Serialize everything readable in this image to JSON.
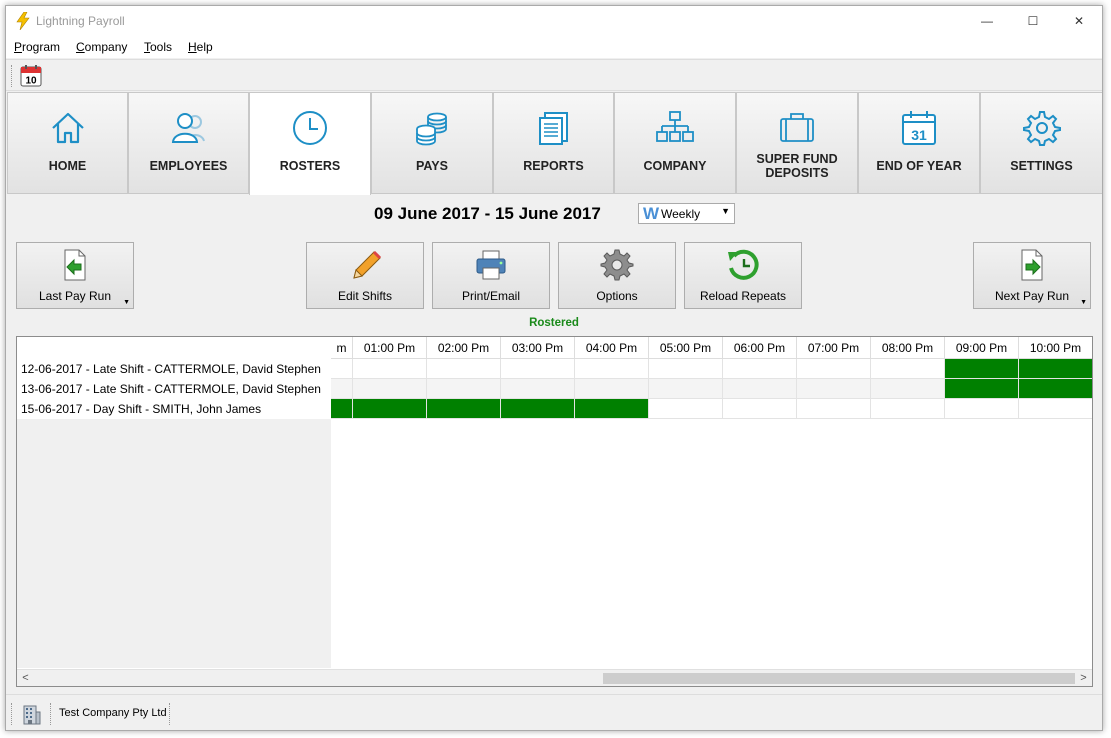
{
  "window": {
    "title": "Lightning Payroll",
    "minimize_glyph": "—",
    "maximize_glyph": "☐",
    "close_glyph": "✕"
  },
  "menu": [
    {
      "accel": "P",
      "rest": "rogram"
    },
    {
      "accel": "C",
      "rest": "ompany"
    },
    {
      "accel": "T",
      "rest": "ools"
    },
    {
      "accel": "H",
      "rest": "elp"
    }
  ],
  "toolbar": {
    "calendar_day": "10",
    "calendar_icon": "calendar-icon"
  },
  "nav": {
    "tabs": [
      {
        "label": "HOME",
        "icon": "home-icon"
      },
      {
        "label": "EMPLOYEES",
        "icon": "employees-icon"
      },
      {
        "label": "ROSTERS",
        "icon": "clock-icon",
        "active": true
      },
      {
        "label": "PAYS",
        "icon": "coins-icon"
      },
      {
        "label": "REPORTS",
        "icon": "reports-icon"
      },
      {
        "label": "COMPANY",
        "icon": "org-chart-icon"
      },
      {
        "label_line1": "SUPER FUND",
        "label_line2": "DEPOSITS",
        "icon": "briefcase-icon"
      },
      {
        "label": "END OF YEAR",
        "icon": "calendar-31-icon",
        "calendar_day": "31"
      },
      {
        "label": "SETTINGS",
        "icon": "gear-icon"
      }
    ]
  },
  "period": {
    "range": "09 June 2017 - 15 June 2017",
    "frequency_badge": "W",
    "frequency": "Weekly",
    "arrow": "▼"
  },
  "actions": {
    "last_pay_run": "Last Pay Run",
    "edit_shifts": "Edit Shifts",
    "print_email": "Print/Email",
    "options": "Options",
    "reload_repeats": "Reload Repeats",
    "next_pay_run": "Next Pay Run",
    "dropdown_glyph": "▼"
  },
  "status_label": "Rostered",
  "roster": {
    "time_columns": [
      "m",
      "01:00 Pm",
      "02:00 Pm",
      "03:00 Pm",
      "04:00 Pm",
      "05:00 Pm",
      "06:00 Pm",
      "07:00 Pm",
      "08:00 Pm",
      "09:00 Pm",
      "10:00 Pm"
    ],
    "shifts": [
      {
        "label": "12-06-2017 - Late Shift - CATTERMOLE, David Stephen",
        "rostered": [
          false,
          false,
          false,
          false,
          false,
          false,
          false,
          false,
          false,
          true,
          true
        ]
      },
      {
        "label": "13-06-2017 - Late Shift - CATTERMOLE, David Stephen",
        "rostered": [
          false,
          false,
          false,
          false,
          false,
          false,
          false,
          false,
          false,
          true,
          true
        ]
      },
      {
        "label": "15-06-2017 - Day Shift - SMITH, John James",
        "rostered": [
          true,
          true,
          true,
          true,
          true,
          false,
          false,
          false,
          false,
          false,
          false
        ]
      }
    ],
    "scroll_left": "<",
    "scroll_right": ">"
  },
  "statusbar": {
    "company": "Test Company Pty Ltd"
  },
  "colors": {
    "rostered_fill": "#008000",
    "rostered_text": "#1a8a1a",
    "icon_blue": "#1e8fc6"
  }
}
